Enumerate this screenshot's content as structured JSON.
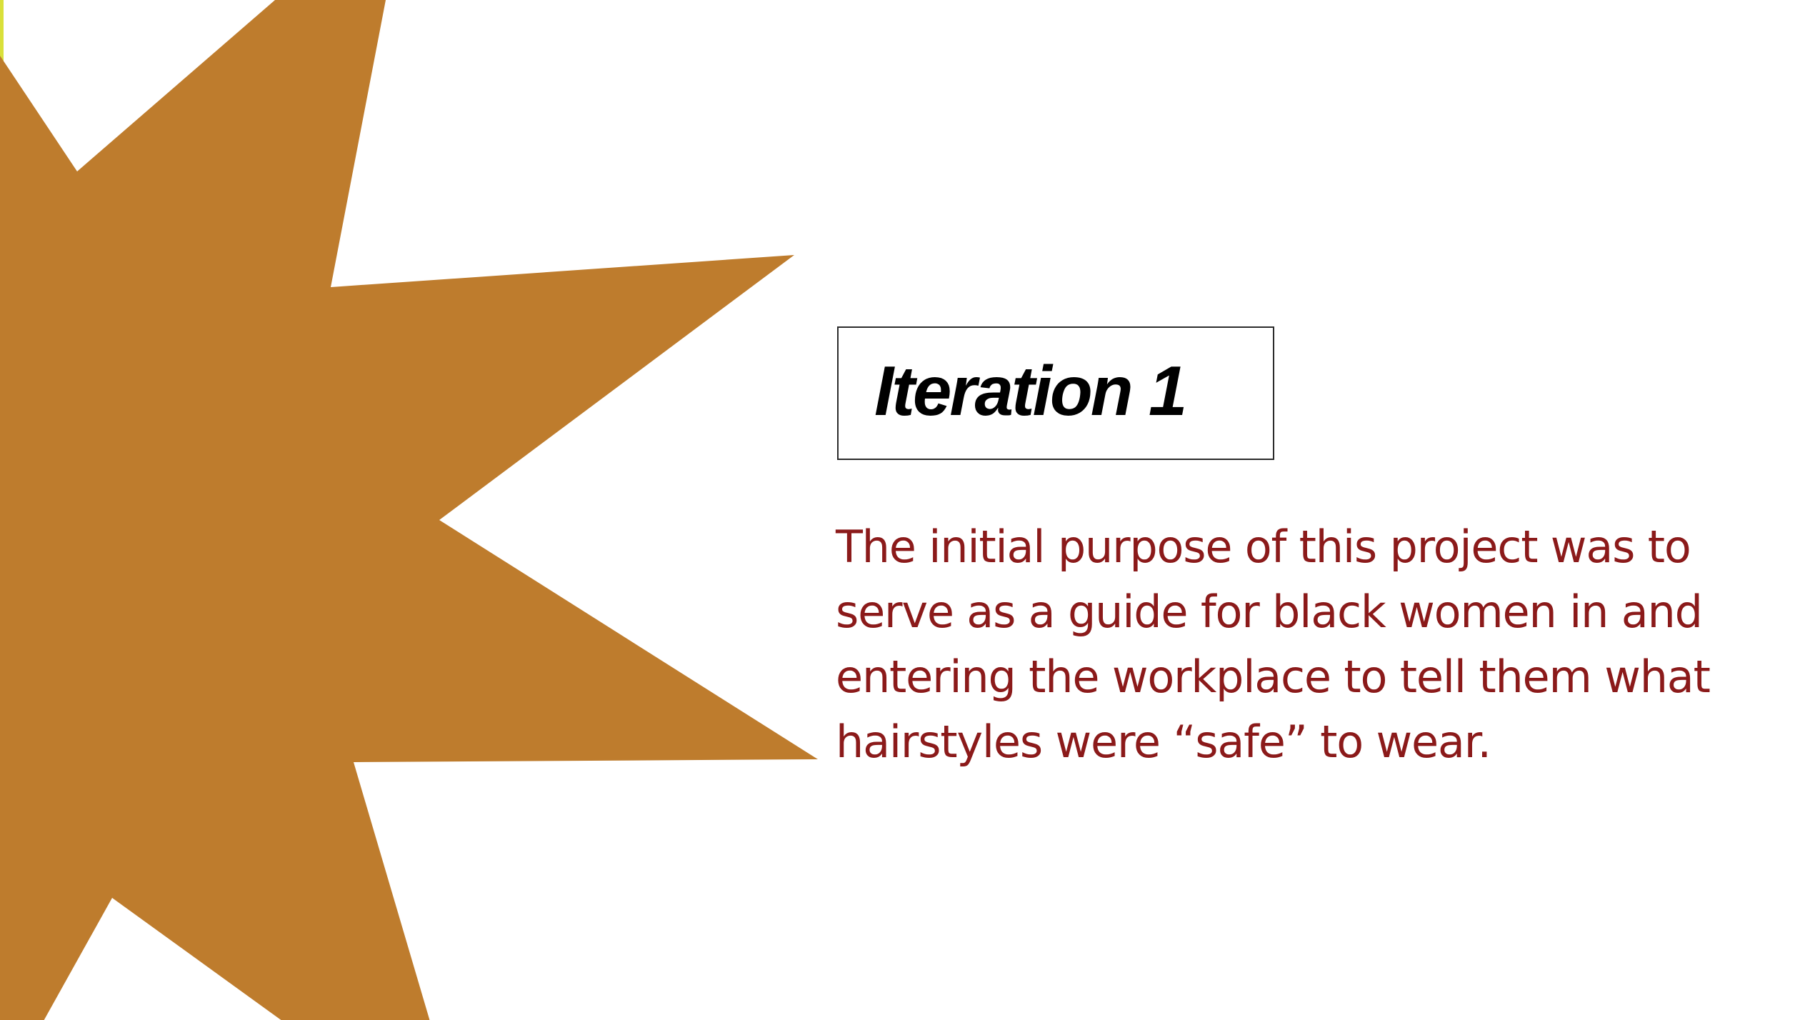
{
  "slide": {
    "title": "Iteration 1",
    "body": "The initial purpose of this project was to serve as a guide for black women in and entering the workplace to tell them what hairstyles were “safe” to wear."
  },
  "colors": {
    "star": "#be7c2d",
    "body_text": "#8b1a1a",
    "title_text": "#000000",
    "left_edge": "#d9e03a",
    "background": "#ffffff"
  },
  "decoration": {
    "shape": "star-burst"
  }
}
